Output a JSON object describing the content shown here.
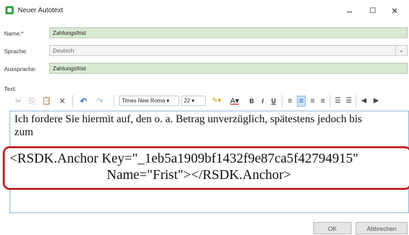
{
  "window": {
    "title": "Neuer Autotext",
    "minimize": "–",
    "maximize": "☐",
    "close": "✕"
  },
  "fields": {
    "name_label": "Name:*",
    "name_value": "Zahlungsfrist",
    "language_label": "Sprache:",
    "language_value": "Deutsch",
    "language_arrow": "⌄",
    "pronunciation_label": "Aussprache:",
    "pronunciation_value": "Zahlungsfrist",
    "text_label": "Text:"
  },
  "toolbar": {
    "cut": "✂",
    "copy": "⎘",
    "paste": "📋",
    "delete": "✕",
    "undo": "↶",
    "redo": "↷",
    "font": "Times New Roma",
    "size": "22",
    "bold": "B",
    "italic": "I",
    "underline": "U",
    "align_left": "≡",
    "align_center": "≡",
    "align_right": "≡",
    "justify": "≡",
    "bullets": "☰",
    "numbering": "☰"
  },
  "editor": {
    "line1": "Ich fordere Sie hiermit auf, den o. a. Betrag unverzüglich, spätestens jedoch bis",
    "line2": "zum",
    "anchor_line1": "<RSDK.Anchor Key=\"_1eb5a1909bf1432f9e87ca5f42794915\"",
    "anchor_line2": "Name=\"Frist\"></RSDK.Anchor>"
  },
  "buttons": {
    "ok": "OK",
    "cancel": "Abbrechen"
  },
  "colors": {
    "accent_green": "#3aa34a",
    "field_green": "#d9ead3",
    "highlight_red": "#c1272d"
  }
}
